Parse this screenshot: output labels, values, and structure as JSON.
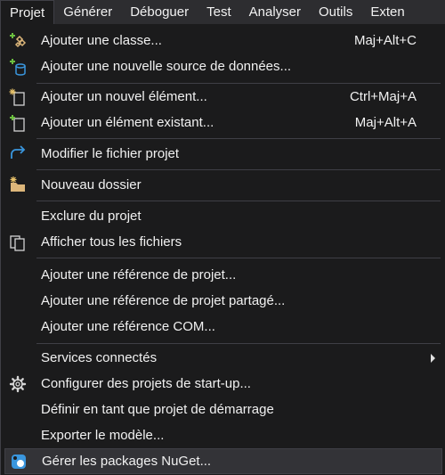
{
  "menubar": {
    "items": [
      "Projet",
      "Générer",
      "Déboguer",
      "Test",
      "Analyser",
      "Outils",
      "Exten"
    ],
    "active_index": 0
  },
  "menu": {
    "items": [
      {
        "label": "Ajouter une classe...",
        "shortcut": "Maj+Alt+C",
        "icon": "add-class-icon"
      },
      {
        "label": "Ajouter une nouvelle source de données...",
        "shortcut": "",
        "icon": "add-datasource-icon"
      },
      {
        "label": "Ajouter un nouvel élément...",
        "shortcut": "Ctrl+Maj+A",
        "icon": "new-item-icon"
      },
      {
        "label": "Ajouter un élément existant...",
        "shortcut": "Maj+Alt+A",
        "icon": "existing-item-icon"
      },
      {
        "label": "Modifier le fichier projet",
        "shortcut": "",
        "icon": "edit-project-icon"
      },
      {
        "label": "Nouveau dossier",
        "shortcut": "",
        "icon": "new-folder-icon"
      },
      {
        "label": "Exclure du projet",
        "shortcut": "",
        "icon": ""
      },
      {
        "label": "Afficher tous les fichiers",
        "shortcut": "",
        "icon": "show-all-files-icon"
      },
      {
        "label": "Ajouter une référence de projet...",
        "shortcut": "",
        "icon": ""
      },
      {
        "label": "Ajouter une référence de projet partagé...",
        "shortcut": "",
        "icon": ""
      },
      {
        "label": "Ajouter une référence COM...",
        "shortcut": "",
        "icon": ""
      },
      {
        "label": "Services connectés",
        "shortcut": "",
        "icon": "",
        "submenu": true
      },
      {
        "label": "Configurer des projets de start-up...",
        "shortcut": "",
        "icon": "gear-icon"
      },
      {
        "label": "Définir en tant que projet de démarrage",
        "shortcut": "",
        "icon": ""
      },
      {
        "label": "Exporter le modèle...",
        "shortcut": "",
        "icon": ""
      },
      {
        "label": "Gérer les packages NuGet...",
        "shortcut": "",
        "icon": "nuget-icon",
        "highlighted": true
      }
    ]
  },
  "colors": {
    "background": "#1b1b1c",
    "menubar": "#2d2d30",
    "separator": "#3f3f46",
    "highlight": "#333337",
    "text": "#f1f1f1",
    "accent_green": "#6cbf3f",
    "accent_blue": "#3a96dd",
    "folder_yellow": "#dcb67a"
  }
}
